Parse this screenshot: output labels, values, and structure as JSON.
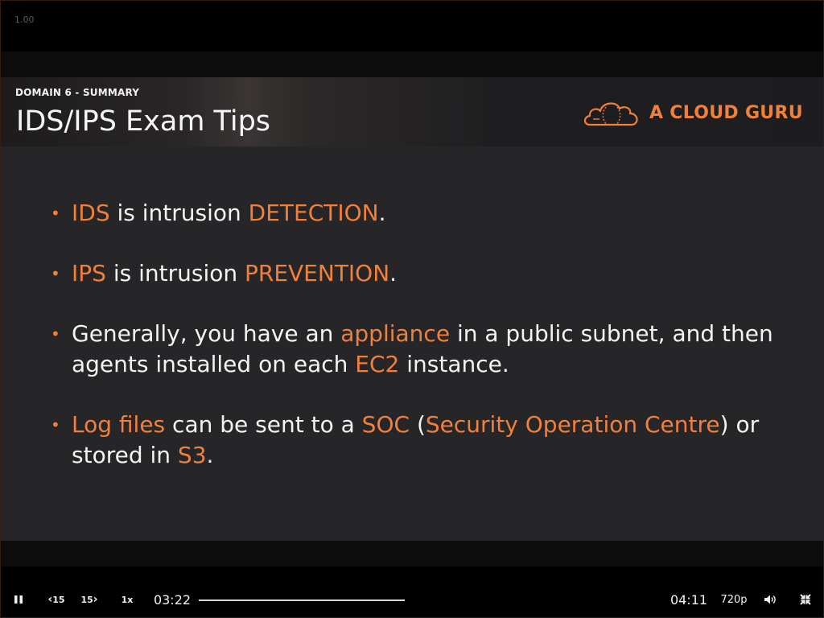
{
  "corner_label": "1.00",
  "slide": {
    "kicker": "DOMAIN 6 - SUMMARY",
    "title": "IDS/IPS Exam Tips",
    "brand": "A CLOUD GURU",
    "bullets": [
      [
        {
          "t": "IDS",
          "hl": true
        },
        {
          "t": " is intrusion ",
          "hl": false
        },
        {
          "t": "DETECTION",
          "hl": true
        },
        {
          "t": ".",
          "hl": false
        }
      ],
      [
        {
          "t": "IPS",
          "hl": true
        },
        {
          "t": " is intrusion ",
          "hl": false
        },
        {
          "t": "PREVENTION",
          "hl": true
        },
        {
          "t": ".",
          "hl": false
        }
      ],
      [
        {
          "t": "Generally, you have an ",
          "hl": false
        },
        {
          "t": "appliance",
          "hl": true
        },
        {
          "t": " in a public subnet, and then agents installed on each ",
          "hl": false
        },
        {
          "t": "EC2",
          "hl": true
        },
        {
          "t": " instance.",
          "hl": false
        }
      ],
      [
        {
          "t": "Log files",
          "hl": true
        },
        {
          "t": " can be sent to a ",
          "hl": false
        },
        {
          "t": "SOC",
          "hl": true
        },
        {
          "t": " (",
          "hl": false
        },
        {
          "t": "Security Operation Centre",
          "hl": true
        },
        {
          "t": ") or stored in ",
          "hl": false
        },
        {
          "t": "S3",
          "hl": true
        },
        {
          "t": ".",
          "hl": false
        }
      ]
    ]
  },
  "player": {
    "pause_icon": "pause-icon",
    "rewind_label": "15",
    "forward_label": "15",
    "speed_label": "1x",
    "current_time": "03:22",
    "duration": "04:11",
    "quality": "720p",
    "volume_icon": "volume-icon",
    "exit_fullscreen_icon": "exit-fullscreen-icon",
    "progress_fraction": 0.0
  },
  "colors": {
    "accent": "#f0803c",
    "slide_bg": "#262528",
    "text": "#f4f4f4"
  }
}
